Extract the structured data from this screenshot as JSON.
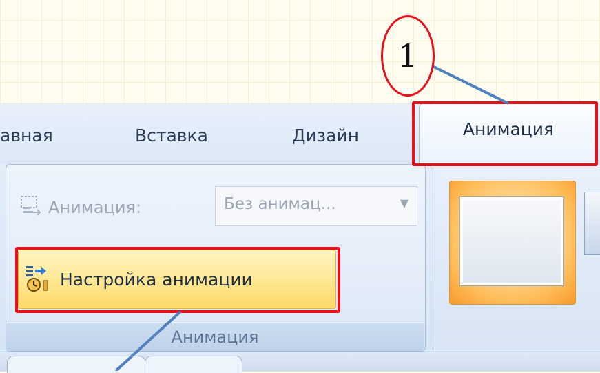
{
  "tabs": [
    {
      "label": "авная"
    },
    {
      "label": "Вставка"
    },
    {
      "label": "Дизайн"
    }
  ],
  "active_tab": {
    "label": "Анимация"
  },
  "group": {
    "animation_label": "Анимация:",
    "animation_value": "Без анимац...",
    "settings_button": "Настройка анимации",
    "caption": "Анимация"
  },
  "annotation": {
    "marker": "1",
    "highlight_color": "#e8101a"
  }
}
